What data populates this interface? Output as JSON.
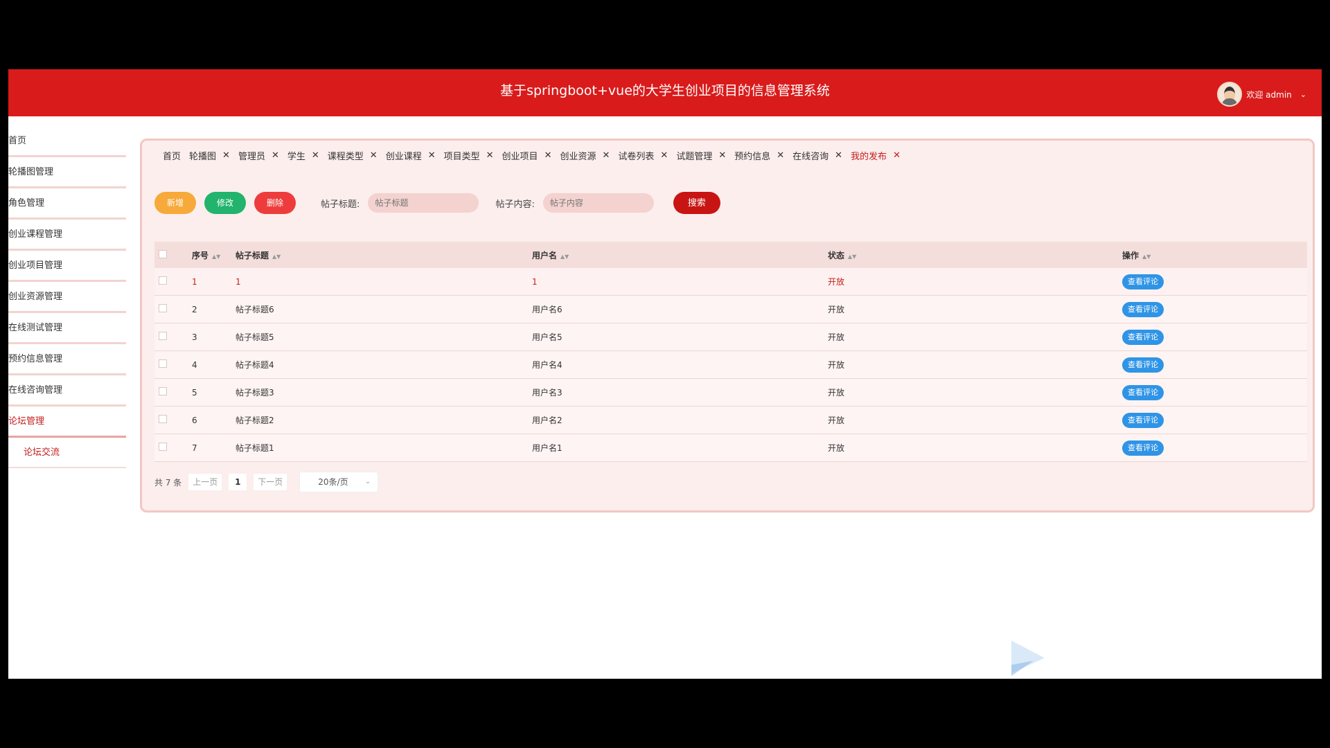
{
  "header": {
    "title": "基于springboot+vue的大学生创业项目的信息管理系统",
    "welcome": "欢迎 admin"
  },
  "sidebar": {
    "items": [
      {
        "label": "首页"
      },
      {
        "label": "轮播图管理"
      },
      {
        "label": "角色管理"
      },
      {
        "label": "创业课程管理"
      },
      {
        "label": "创业项目管理"
      },
      {
        "label": "创业资源管理"
      },
      {
        "label": "在线测试管理"
      },
      {
        "label": "预约信息管理"
      },
      {
        "label": "在线咨询管理"
      },
      {
        "label": "论坛管理"
      }
    ],
    "sub_item": "论坛交流"
  },
  "tabs": [
    {
      "label": "首页"
    },
    {
      "label": "轮播图"
    },
    {
      "label": "管理员"
    },
    {
      "label": "学生"
    },
    {
      "label": "课程类型"
    },
    {
      "label": "创业课程"
    },
    {
      "label": "项目类型"
    },
    {
      "label": "创业项目"
    },
    {
      "label": "创业资源"
    },
    {
      "label": "试卷列表"
    },
    {
      "label": "试题管理"
    },
    {
      "label": "预约信息"
    },
    {
      "label": "在线咨询"
    },
    {
      "label": "我的发布"
    }
  ],
  "toolbar": {
    "add": "新增",
    "edit": "修改",
    "delete": "删除",
    "title_label": "帖子标题:",
    "title_placeholder": "帖子标题",
    "content_label": "帖子内容:",
    "content_placeholder": "帖子内容",
    "search": "搜索"
  },
  "table": {
    "headers": {
      "idx": "序号",
      "title": "帖子标题",
      "user": "用户名",
      "state": "状态",
      "op": "操作"
    },
    "op_label": "查看评论",
    "rows": [
      {
        "idx": "1",
        "title": "1",
        "user": "1",
        "state": "开放"
      },
      {
        "idx": "2",
        "title": "帖子标题6",
        "user": "用户名6",
        "state": "开放"
      },
      {
        "idx": "3",
        "title": "帖子标题5",
        "user": "用户名5",
        "state": "开放"
      },
      {
        "idx": "4",
        "title": "帖子标题4",
        "user": "用户名4",
        "state": "开放"
      },
      {
        "idx": "5",
        "title": "帖子标题3",
        "user": "用户名3",
        "state": "开放"
      },
      {
        "idx": "6",
        "title": "帖子标题2",
        "user": "用户名2",
        "state": "开放"
      },
      {
        "idx": "7",
        "title": "帖子标题1",
        "user": "用户名1",
        "state": "开放"
      }
    ]
  },
  "pager": {
    "total": "共 7 条",
    "prev": "上一页",
    "page": "1",
    "next": "下一页",
    "size": "20条/页"
  },
  "colors": {
    "header": "#d91b1b",
    "accent": "#c41d1d",
    "op": "#2f94e6"
  }
}
